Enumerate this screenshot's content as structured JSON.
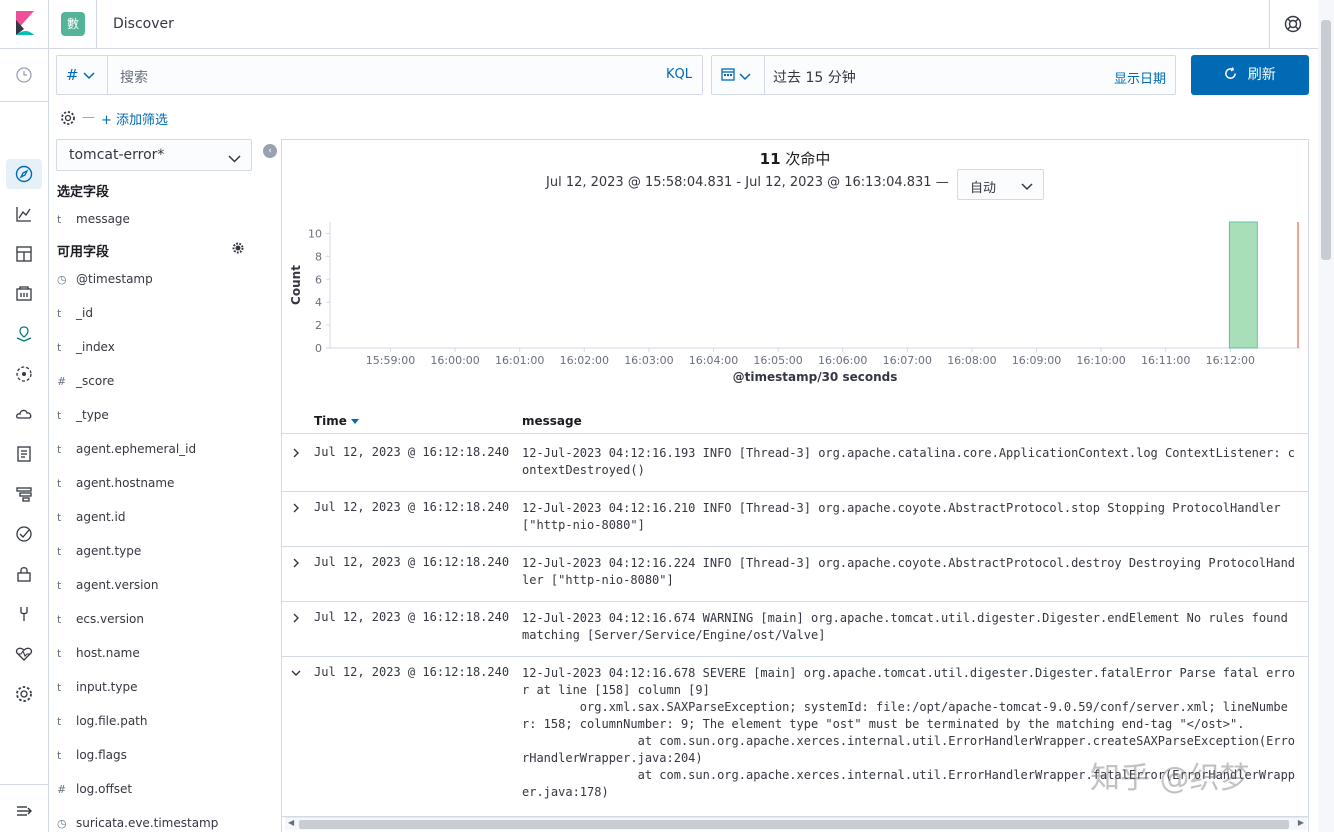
{
  "header": {
    "app_badge": "數",
    "breadcrumb": "Discover"
  },
  "query": {
    "lang_symbol": "#",
    "placeholder": "搜索",
    "kql_label": "KQL"
  },
  "date": {
    "range": "过去 15 分钟",
    "show_dates": "显示日期"
  },
  "refresh_label": "刷新",
  "filter": {
    "dash": "—",
    "add_label": "+ 添加筛选"
  },
  "index_pattern": "tomcat-error*",
  "selected_fields_title": "选定字段",
  "selected_fields": [
    {
      "type": "t",
      "name": "message"
    }
  ],
  "available_fields_title": "可用字段",
  "available_fields": [
    {
      "type": "◷",
      "name": "@timestamp"
    },
    {
      "type": "t",
      "name": "_id"
    },
    {
      "type": "t",
      "name": "_index"
    },
    {
      "type": "#",
      "name": "_score"
    },
    {
      "type": "t",
      "name": "_type"
    },
    {
      "type": "t",
      "name": "agent.ephemeral_id"
    },
    {
      "type": "t",
      "name": "agent.hostname"
    },
    {
      "type": "t",
      "name": "agent.id"
    },
    {
      "type": "t",
      "name": "agent.type"
    },
    {
      "type": "t",
      "name": "agent.version"
    },
    {
      "type": "t",
      "name": "ecs.version"
    },
    {
      "type": "t",
      "name": "host.name"
    },
    {
      "type": "t",
      "name": "input.type"
    },
    {
      "type": "t",
      "name": "log.file.path"
    },
    {
      "type": "t",
      "name": "log.flags"
    },
    {
      "type": "#",
      "name": "log.offset"
    },
    {
      "type": "◷",
      "name": "suricata.eve.timestamp"
    }
  ],
  "hits": {
    "count": "11",
    "label": "次命中"
  },
  "time_range": "Jul 12, 2023 @ 15:58:04.831 - Jul 12, 2023 @ 16:13:04.831 —",
  "interval": "自动",
  "chart_data": {
    "type": "bar",
    "ylabel": "Count",
    "xlabel": "@timestamp/30 seconds",
    "yticks": [
      0,
      2,
      4,
      6,
      8,
      10
    ],
    "ylim": [
      0,
      11
    ],
    "xticks": [
      "15:59:00",
      "16:00:00",
      "16:01:00",
      "16:02:00",
      "16:03:00",
      "16:04:00",
      "16:05:00",
      "16:06:00",
      "16:07:00",
      "16:08:00",
      "16:09:00",
      "16:10:00",
      "16:11:00",
      "16:12:00"
    ],
    "x": [
      "16:12:00"
    ],
    "values": [
      11
    ],
    "bar_color": "#a8dfb8",
    "now_marker_color": "#e7664c"
  },
  "table": {
    "col_time": "Time",
    "col_message": "message",
    "rows": [
      {
        "time": "Jul 12, 2023 @ 16:12:18.240",
        "message": "12-Jul-2023 04:12:16.193 INFO [Thread-3] org.apache.catalina.core.ApplicationContext.log ContextListener: contextDestroyed()",
        "expanded": false
      },
      {
        "time": "Jul 12, 2023 @ 16:12:18.240",
        "message": "12-Jul-2023 04:12:16.210 INFO [Thread-3] org.apache.coyote.AbstractProtocol.stop Stopping ProtocolHandler [\"http-nio-8080\"]",
        "expanded": false
      },
      {
        "time": "Jul 12, 2023 @ 16:12:18.240",
        "message": "12-Jul-2023 04:12:16.224 INFO [Thread-3] org.apache.coyote.AbstractProtocol.destroy Destroying ProtocolHandler [\"http-nio-8080\"]",
        "expanded": false
      },
      {
        "time": "Jul 12, 2023 @ 16:12:18.240",
        "message": "12-Jul-2023 04:12:16.674 WARNING [main] org.apache.tomcat.util.digester.Digester.endElement No rules found matching [Server/Service/Engine/ost/Valve]",
        "expanded": false
      },
      {
        "time": "Jul 12, 2023 @ 16:12:18.240",
        "message": "12-Jul-2023 04:12:16.678 SEVERE [main] org.apache.tomcat.util.digester.Digester.fatalError Parse fatal error at line [158] column [9]\n        org.xml.sax.SAXParseException; systemId: file:/opt/apache-tomcat-9.0.59/conf/server.xml; lineNumber: 158; columnNumber: 9; The element type \"ost\" must be terminated by the matching end-tag \"</ost>\".\n                at com.sun.org.apache.xerces.internal.util.ErrorHandlerWrapper.createSAXParseException(ErrorHandlerWrapper.java:204)\n                at com.sun.org.apache.xerces.internal.util.ErrorHandlerWrapper.fatalError(ErrorHandlerWrapper.java:178)",
        "expanded": true
      }
    ]
  },
  "watermark": "知乎 @织梦"
}
